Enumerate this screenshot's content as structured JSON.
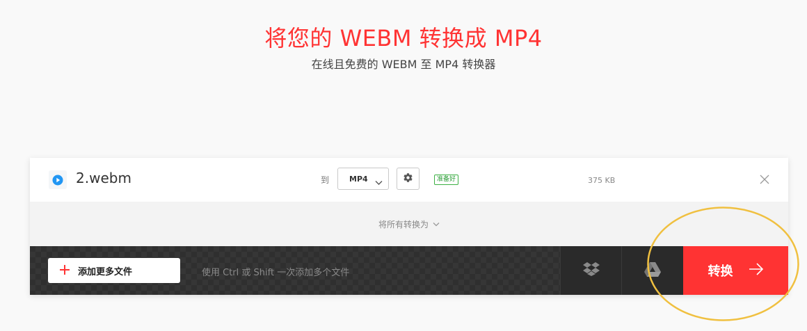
{
  "header": {
    "title": "将您的 WEBM 转换成 MP4",
    "subtitle": "在线且免费的 WEBM 至 MP4 转换器"
  },
  "file": {
    "icon": "play-icon",
    "name": "2.webm",
    "to_label": "到",
    "format_selected": "MP4",
    "status": "准备好",
    "size": "375 KB"
  },
  "convert_all": {
    "label": "将所有转换为"
  },
  "toolbar": {
    "add_files_label": "添加更多文件",
    "hint": "使用 Ctrl 或 Shift 一次添加多个文件",
    "dropbox_icon": "dropbox-icon",
    "gdrive_icon": "google-drive-icon",
    "convert_label": "转换"
  },
  "colors": {
    "accent": "#ff3333",
    "status_green": "#3cb043",
    "annotation": "#f0c040"
  }
}
